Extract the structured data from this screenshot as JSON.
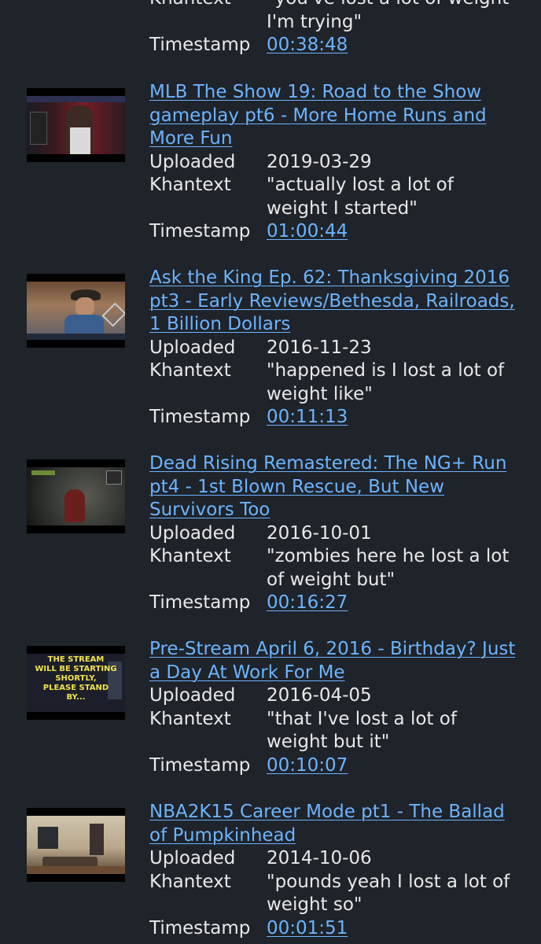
{
  "partial_result": {
    "khantext_line": "\"you've lost a lot of weight",
    "khantext_line2": "I'm trying\"",
    "timestamp_label": "Timestamp",
    "timestamp": "00:38:48"
  },
  "labels": {
    "uploaded": "Uploaded",
    "khantext": "Khantext",
    "timestamp": "Timestamp"
  },
  "results": [
    {
      "title": "MLB The Show 19: Road to the Show gameplay pt6 - More Home Runs and More Fun",
      "uploaded": "2019-03-29",
      "khantext": "\"actually lost a lot of weight I started\"",
      "timestamp": "01:00:44"
    },
    {
      "title": "Ask the King Ep. 62: Thanksgiving 2016 pt3 - Early Reviews/Bethesda, Railroads, 1 Billion Dollars",
      "uploaded": "2016-11-23",
      "khantext": "\"happened is I lost a lot of weight like\"",
      "timestamp": "00:11:13"
    },
    {
      "title": "Dead Rising Remastered: The NG+ Run pt4 - 1st Blown Rescue, But New Survivors Too",
      "uploaded": "2016-10-01",
      "khantext": "\"zombies here he lost a lot of weight but\"",
      "timestamp": "00:16:27"
    },
    {
      "title": "Pre-Stream April 6, 2016 - Birthday? Just a Day At Work For Me",
      "uploaded": "2016-04-05",
      "khantext": "\"that I've lost a lot of weight but it\"",
      "timestamp": "00:10:07",
      "thumb_text": [
        "THE STREAM",
        "WILL BE STARTING",
        "SHORTLY,",
        "PLEASE STAND",
        "BY..."
      ]
    },
    {
      "title": "NBA2K15 Career Mode pt1 - The Ballad of Pumpkinhead",
      "uploaded": "2014-10-06",
      "khantext": "\"pounds yeah I lost a lot of weight so\"",
      "timestamp": "00:01:51"
    }
  ],
  "colors": {
    "background": "#1f232a",
    "text": "#e9e9e9",
    "link": "#6cb4ff"
  }
}
